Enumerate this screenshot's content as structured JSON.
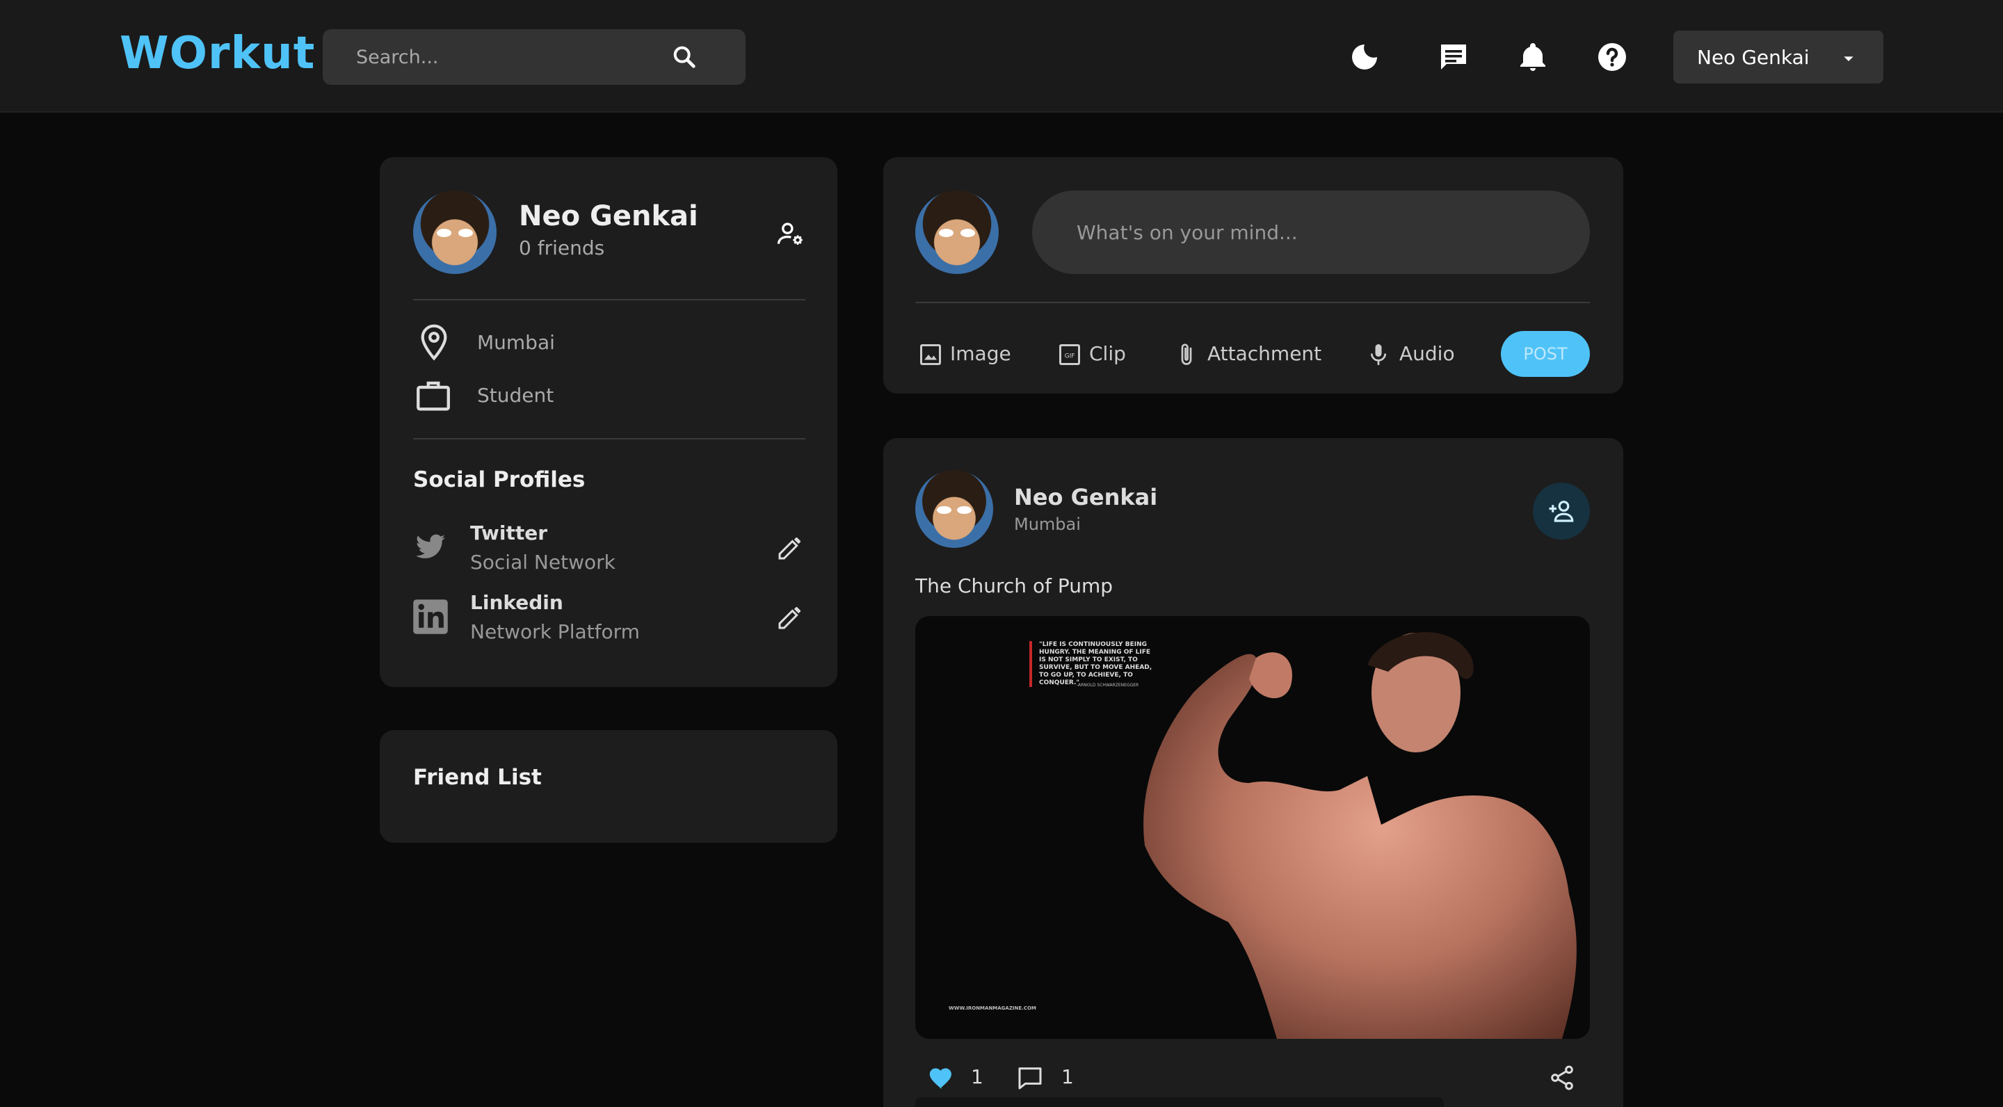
{
  "app": {
    "logo": "WOrkut"
  },
  "search": {
    "placeholder": "Search..."
  },
  "nav": {
    "icons": [
      "moon-icon",
      "chat-icon",
      "bell-icon",
      "help-icon"
    ],
    "user_menu_label": "Neo Genkai"
  },
  "profile": {
    "name": "Neo Genkai",
    "friends": "0 friends",
    "location": "Mumbai",
    "occupation": "Student",
    "social_title": "Social Profiles",
    "socials": [
      {
        "name": "Twitter",
        "subtitle": "Social Network",
        "icon": "twitter-icon"
      },
      {
        "name": "Linkedin",
        "subtitle": "Network Platform",
        "icon": "linkedin-icon"
      }
    ]
  },
  "friend_list": {
    "title": "Friend List"
  },
  "composer": {
    "placeholder": "What's on your mind...",
    "actions": [
      "Image",
      "Clip",
      "Attachment",
      "Audio"
    ],
    "post_label": "POST"
  },
  "post": {
    "author": "Neo Genkai",
    "location": "Mumbai",
    "caption": "The Church of Pump",
    "image_quote": "\"LIFE IS CONTINUOUSLY BEING HUNGRY. THE MEANING OF LIFE IS NOT SIMPLY TO EXIST, TO SURVIVE, BUT TO MOVE AHEAD, TO GO UP, TO ACHIEVE, TO CONQUER.\"",
    "image_quote_author": "-ARNOLD SCHWARZENEGGER",
    "image_site": "WWW.IRONMANMAGAZINE.COM",
    "likes": "1",
    "comments": "1"
  },
  "colors": {
    "accent": "#4fc3f7",
    "background": "#0a0a0a",
    "card": "#1d1d1d"
  }
}
